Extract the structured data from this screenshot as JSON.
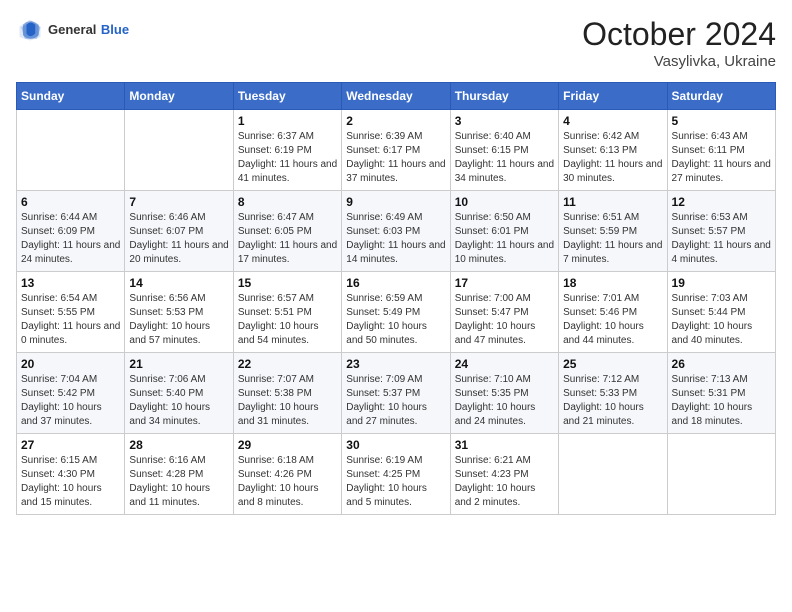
{
  "header": {
    "logo": {
      "text_general": "General",
      "text_blue": "Blue"
    },
    "title": "October 2024",
    "subtitle": "Vasylivka, Ukraine"
  },
  "weekdays": [
    "Sunday",
    "Monday",
    "Tuesday",
    "Wednesday",
    "Thursday",
    "Friday",
    "Saturday"
  ],
  "weeks": [
    [
      {
        "day": "",
        "sunrise": "",
        "sunset": "",
        "daylight": ""
      },
      {
        "day": "",
        "sunrise": "",
        "sunset": "",
        "daylight": ""
      },
      {
        "day": "1",
        "sunrise": "Sunrise: 6:37 AM",
        "sunset": "Sunset: 6:19 PM",
        "daylight": "Daylight: 11 hours and 41 minutes."
      },
      {
        "day": "2",
        "sunrise": "Sunrise: 6:39 AM",
        "sunset": "Sunset: 6:17 PM",
        "daylight": "Daylight: 11 hours and 37 minutes."
      },
      {
        "day": "3",
        "sunrise": "Sunrise: 6:40 AM",
        "sunset": "Sunset: 6:15 PM",
        "daylight": "Daylight: 11 hours and 34 minutes."
      },
      {
        "day": "4",
        "sunrise": "Sunrise: 6:42 AM",
        "sunset": "Sunset: 6:13 PM",
        "daylight": "Daylight: 11 hours and 30 minutes."
      },
      {
        "day": "5",
        "sunrise": "Sunrise: 6:43 AM",
        "sunset": "Sunset: 6:11 PM",
        "daylight": "Daylight: 11 hours and 27 minutes."
      }
    ],
    [
      {
        "day": "6",
        "sunrise": "Sunrise: 6:44 AM",
        "sunset": "Sunset: 6:09 PM",
        "daylight": "Daylight: 11 hours and 24 minutes."
      },
      {
        "day": "7",
        "sunrise": "Sunrise: 6:46 AM",
        "sunset": "Sunset: 6:07 PM",
        "daylight": "Daylight: 11 hours and 20 minutes."
      },
      {
        "day": "8",
        "sunrise": "Sunrise: 6:47 AM",
        "sunset": "Sunset: 6:05 PM",
        "daylight": "Daylight: 11 hours and 17 minutes."
      },
      {
        "day": "9",
        "sunrise": "Sunrise: 6:49 AM",
        "sunset": "Sunset: 6:03 PM",
        "daylight": "Daylight: 11 hours and 14 minutes."
      },
      {
        "day": "10",
        "sunrise": "Sunrise: 6:50 AM",
        "sunset": "Sunset: 6:01 PM",
        "daylight": "Daylight: 11 hours and 10 minutes."
      },
      {
        "day": "11",
        "sunrise": "Sunrise: 6:51 AM",
        "sunset": "Sunset: 5:59 PM",
        "daylight": "Daylight: 11 hours and 7 minutes."
      },
      {
        "day": "12",
        "sunrise": "Sunrise: 6:53 AM",
        "sunset": "Sunset: 5:57 PM",
        "daylight": "Daylight: 11 hours and 4 minutes."
      }
    ],
    [
      {
        "day": "13",
        "sunrise": "Sunrise: 6:54 AM",
        "sunset": "Sunset: 5:55 PM",
        "daylight": "Daylight: 11 hours and 0 minutes."
      },
      {
        "day": "14",
        "sunrise": "Sunrise: 6:56 AM",
        "sunset": "Sunset: 5:53 PM",
        "daylight": "Daylight: 10 hours and 57 minutes."
      },
      {
        "day": "15",
        "sunrise": "Sunrise: 6:57 AM",
        "sunset": "Sunset: 5:51 PM",
        "daylight": "Daylight: 10 hours and 54 minutes."
      },
      {
        "day": "16",
        "sunrise": "Sunrise: 6:59 AM",
        "sunset": "Sunset: 5:49 PM",
        "daylight": "Daylight: 10 hours and 50 minutes."
      },
      {
        "day": "17",
        "sunrise": "Sunrise: 7:00 AM",
        "sunset": "Sunset: 5:47 PM",
        "daylight": "Daylight: 10 hours and 47 minutes."
      },
      {
        "day": "18",
        "sunrise": "Sunrise: 7:01 AM",
        "sunset": "Sunset: 5:46 PM",
        "daylight": "Daylight: 10 hours and 44 minutes."
      },
      {
        "day": "19",
        "sunrise": "Sunrise: 7:03 AM",
        "sunset": "Sunset: 5:44 PM",
        "daylight": "Daylight: 10 hours and 40 minutes."
      }
    ],
    [
      {
        "day": "20",
        "sunrise": "Sunrise: 7:04 AM",
        "sunset": "Sunset: 5:42 PM",
        "daylight": "Daylight: 10 hours and 37 minutes."
      },
      {
        "day": "21",
        "sunrise": "Sunrise: 7:06 AM",
        "sunset": "Sunset: 5:40 PM",
        "daylight": "Daylight: 10 hours and 34 minutes."
      },
      {
        "day": "22",
        "sunrise": "Sunrise: 7:07 AM",
        "sunset": "Sunset: 5:38 PM",
        "daylight": "Daylight: 10 hours and 31 minutes."
      },
      {
        "day": "23",
        "sunrise": "Sunrise: 7:09 AM",
        "sunset": "Sunset: 5:37 PM",
        "daylight": "Daylight: 10 hours and 27 minutes."
      },
      {
        "day": "24",
        "sunrise": "Sunrise: 7:10 AM",
        "sunset": "Sunset: 5:35 PM",
        "daylight": "Daylight: 10 hours and 24 minutes."
      },
      {
        "day": "25",
        "sunrise": "Sunrise: 7:12 AM",
        "sunset": "Sunset: 5:33 PM",
        "daylight": "Daylight: 10 hours and 21 minutes."
      },
      {
        "day": "26",
        "sunrise": "Sunrise: 7:13 AM",
        "sunset": "Sunset: 5:31 PM",
        "daylight": "Daylight: 10 hours and 18 minutes."
      }
    ],
    [
      {
        "day": "27",
        "sunrise": "Sunrise: 6:15 AM",
        "sunset": "Sunset: 4:30 PM",
        "daylight": "Daylight: 10 hours and 15 minutes."
      },
      {
        "day": "28",
        "sunrise": "Sunrise: 6:16 AM",
        "sunset": "Sunset: 4:28 PM",
        "daylight": "Daylight: 10 hours and 11 minutes."
      },
      {
        "day": "29",
        "sunrise": "Sunrise: 6:18 AM",
        "sunset": "Sunset: 4:26 PM",
        "daylight": "Daylight: 10 hours and 8 minutes."
      },
      {
        "day": "30",
        "sunrise": "Sunrise: 6:19 AM",
        "sunset": "Sunset: 4:25 PM",
        "daylight": "Daylight: 10 hours and 5 minutes."
      },
      {
        "day": "31",
        "sunrise": "Sunrise: 6:21 AM",
        "sunset": "Sunset: 4:23 PM",
        "daylight": "Daylight: 10 hours and 2 minutes."
      },
      {
        "day": "",
        "sunrise": "",
        "sunset": "",
        "daylight": ""
      },
      {
        "day": "",
        "sunrise": "",
        "sunset": "",
        "daylight": ""
      }
    ]
  ]
}
